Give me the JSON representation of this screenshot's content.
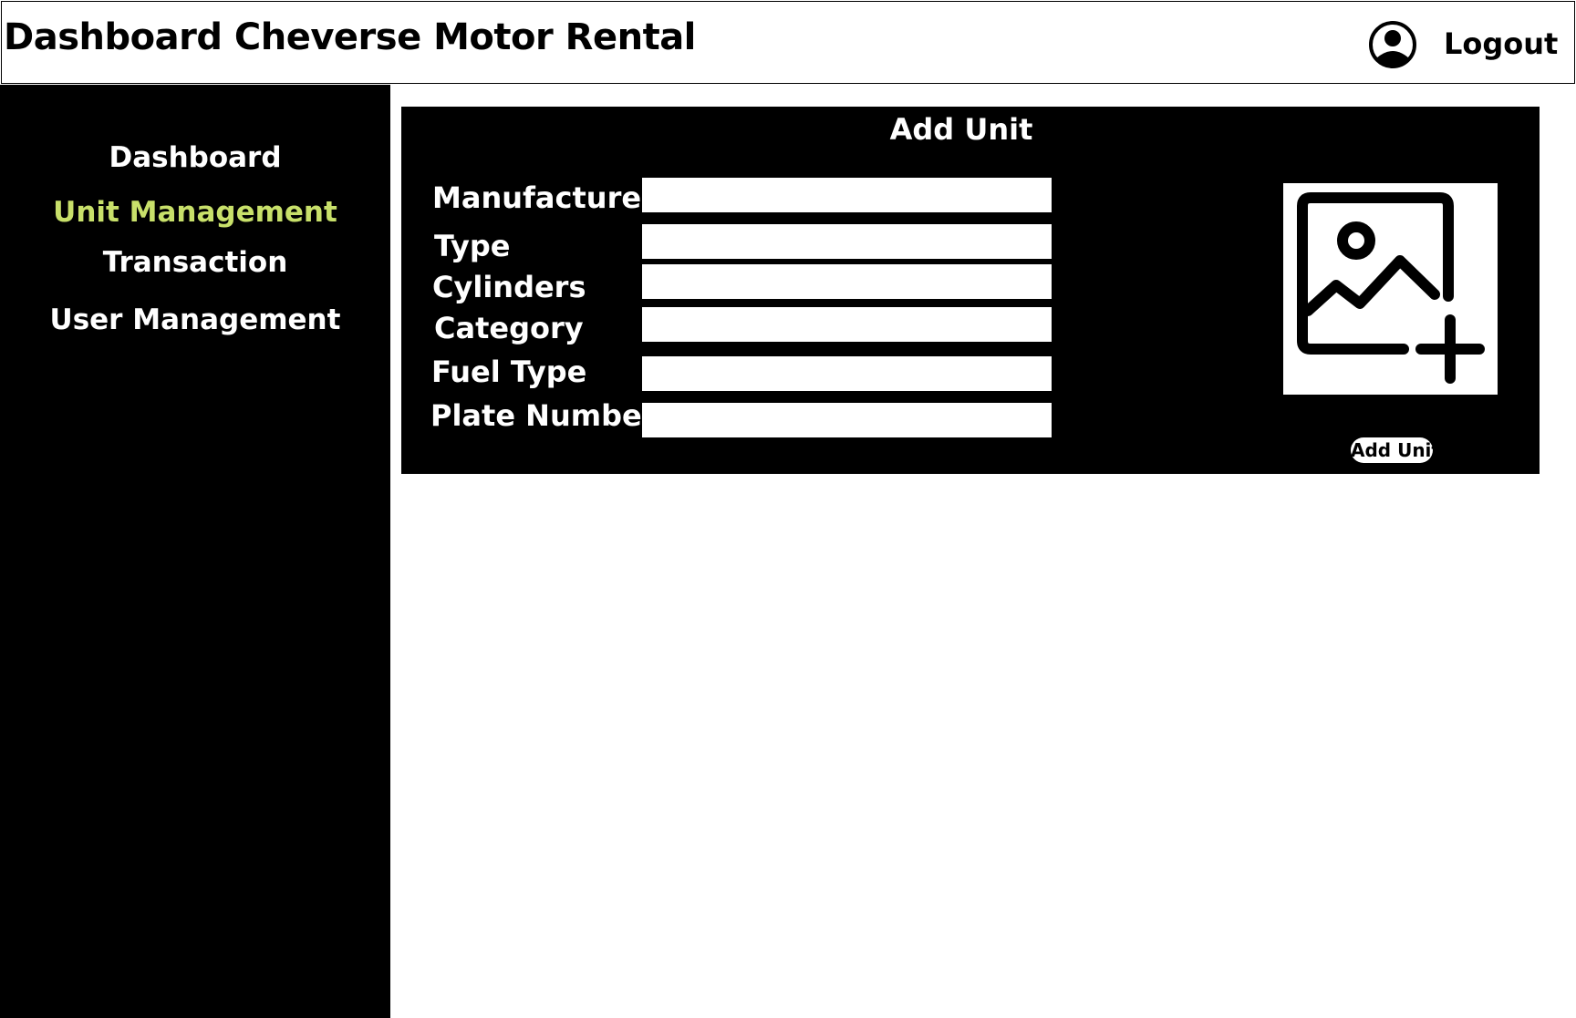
{
  "header": {
    "title": "Dashboard Cheverse Motor Rental",
    "user_icon": "user-circle-icon",
    "logout_label": "Logout"
  },
  "sidebar": {
    "items": [
      {
        "label": "Dashboard",
        "active": false
      },
      {
        "label": "Unit Management",
        "active": true
      },
      {
        "label": "Transaction",
        "active": false
      },
      {
        "label": "User Management",
        "active": false
      }
    ],
    "active_color": "#c8e06a"
  },
  "form": {
    "title": "Add Unit",
    "fields": [
      {
        "label": "Manufacturer",
        "value": ""
      },
      {
        "label": "Type",
        "value": ""
      },
      {
        "label": "Cylinders",
        "value": ""
      },
      {
        "label": "Category",
        "value": ""
      },
      {
        "label": "Fuel Type",
        "value": ""
      },
      {
        "label": "Plate Number",
        "value": ""
      }
    ],
    "image_upload_icon": "add-image-icon",
    "submit_label": "Add Unit"
  },
  "colors": {
    "sidebar_bg": "#000000",
    "panel_bg": "#000000",
    "text_light": "#ffffff",
    "active_nav": "#c8e06a"
  }
}
